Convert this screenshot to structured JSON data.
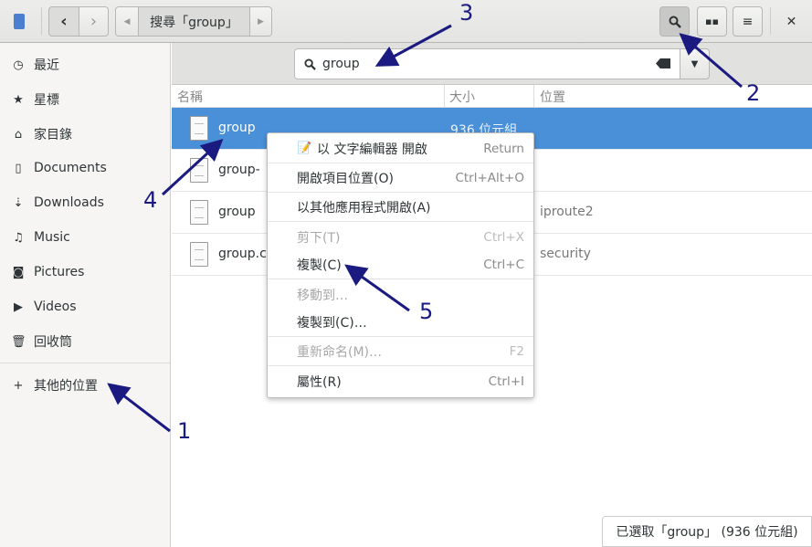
{
  "header": {
    "path_label": "搜尋「group」",
    "icons": [
      "files-app-icon",
      "back-icon",
      "forward-icon",
      "path-left-icon",
      "path-right-icon",
      "search-icon",
      "grid-view-icon",
      "menu-icon",
      "close-icon"
    ]
  },
  "sidebar": {
    "items": [
      {
        "label": "最近",
        "icon": "clock-icon"
      },
      {
        "label": "星標",
        "icon": "star-icon"
      },
      {
        "label": "家目錄",
        "icon": "home-icon"
      },
      {
        "label": "Documents",
        "icon": "document-icon"
      },
      {
        "label": "Downloads",
        "icon": "download-icon"
      },
      {
        "label": "Music",
        "icon": "music-icon"
      },
      {
        "label": "Pictures",
        "icon": "camera-icon"
      },
      {
        "label": "Videos",
        "icon": "video-icon"
      },
      {
        "label": "回收筒",
        "icon": "trash-icon"
      }
    ],
    "other_locations": "其他的位置"
  },
  "search": {
    "value": "group"
  },
  "columns": {
    "name": "名稱",
    "size": "大小",
    "location": "位置"
  },
  "files": [
    {
      "name": "group",
      "size": "936 位元組",
      "location": ""
    },
    {
      "name": "group-",
      "size": "",
      "location": ""
    },
    {
      "name": "group",
      "size": "",
      "location": "iproute2"
    },
    {
      "name": "group.co",
      "size": "",
      "location": "security"
    }
  ],
  "context_menu": [
    {
      "label": "以 文字編輯器 開啟",
      "accel": "Return",
      "disabled": false
    },
    {
      "label": "開啟項目位置(O)",
      "accel": "Ctrl+Alt+O",
      "disabled": false
    },
    {
      "label": "以其他應用程式開啟(A)",
      "accel": "",
      "disabled": false
    },
    {
      "label": "剪下(T)",
      "accel": "Ctrl+X",
      "disabled": true
    },
    {
      "label": "複製(C)",
      "accel": "Ctrl+C",
      "disabled": false
    },
    {
      "label": "移動到…",
      "accel": "",
      "disabled": true
    },
    {
      "label": "複製到(C)…",
      "accel": "",
      "disabled": false
    },
    {
      "label": "重新命名(M)…",
      "accel": "F2",
      "disabled": true
    },
    {
      "label": "屬性(R)",
      "accel": "Ctrl+I",
      "disabled": false
    }
  ],
  "status": "已選取「group」 (936 位元組)",
  "annotations": [
    "1",
    "2",
    "3",
    "4",
    "5"
  ],
  "colors": {
    "selection": "#4a90d9",
    "annotation": "#1a1a80"
  }
}
